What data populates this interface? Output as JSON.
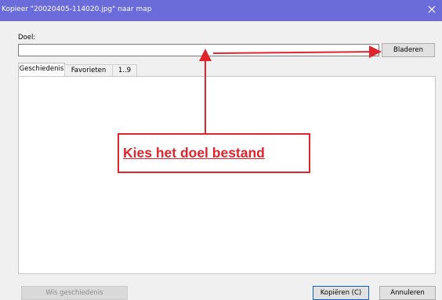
{
  "window": {
    "title": "Kopieer \"20020405-114020.jpg\" naar map",
    "close_icon": "close-icon",
    "titlebar_color": "#6b6bd9"
  },
  "form": {
    "doel_label": "Doel:",
    "doel_value": "",
    "bladeren_label": "Bladeren"
  },
  "tabs": [
    {
      "label": "Geschiedenis",
      "active": true
    },
    {
      "label": "Favorieten",
      "active": false
    },
    {
      "label": "1..9",
      "active": false
    }
  ],
  "footer": {
    "wis_label": "Wis geschiedenis",
    "kopieren_label": "Kopiëren (C)",
    "annuleren_label": "Annuleren"
  },
  "annotation": {
    "text": "Kies het doel bestand",
    "color": "#e0242e"
  }
}
